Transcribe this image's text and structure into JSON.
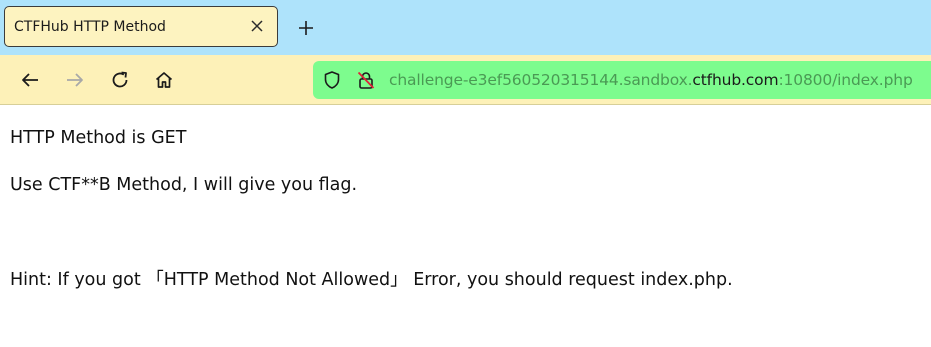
{
  "browser": {
    "tab": {
      "title": "CTFHub HTTP Method",
      "close_icon": "close-icon"
    },
    "new_tab_icon": "plus-icon",
    "nav": {
      "back_icon": "arrow-left-icon",
      "forward_icon": "arrow-right-icon",
      "reload_icon": "reload-icon",
      "home_icon": "home-icon"
    },
    "address_bar": {
      "shield_icon": "shield-icon",
      "lock_icon": "lock-insecure-icon",
      "url_subdomain": "challenge-e3ef560520315144.sandbox.",
      "url_domain": "ctfhub.com",
      "url_rest": ":10800/index.php",
      "bar_color": "#7dfc8e"
    },
    "tabbar_color": "#aee3fb",
    "toolbar_color": "#fdf1b8"
  },
  "page": {
    "line1": "HTTP Method is GET",
    "line2": "Use CTF**B Method, I will give you flag.",
    "line3": "Hint: If you got 「HTTP Method Not Allowed」 Error, you should request index.php."
  }
}
